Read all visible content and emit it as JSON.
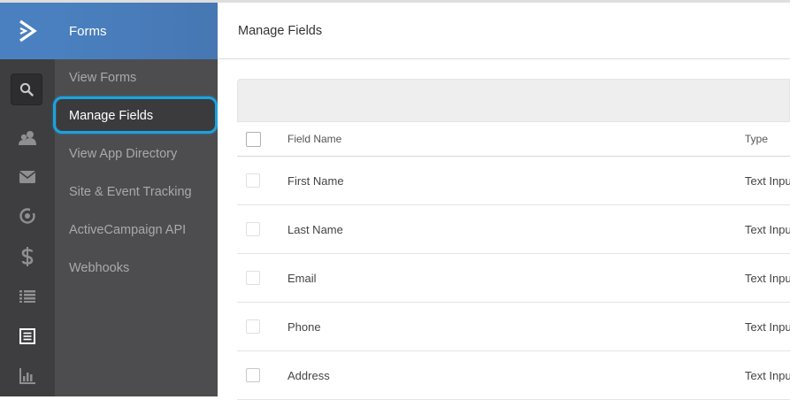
{
  "app": {
    "section_title": "Forms"
  },
  "rail": {
    "icons": [
      "search-icon",
      "contacts-icon",
      "mail-icon",
      "automation-icon",
      "dollar-icon",
      "list-icon",
      "forms-icon",
      "reports-icon"
    ]
  },
  "subnav": {
    "items": [
      {
        "label": "View Forms"
      },
      {
        "label": "Manage Fields"
      },
      {
        "label": "View App Directory"
      },
      {
        "label": "Site & Event Tracking"
      },
      {
        "label": "ActiveCampaign API"
      },
      {
        "label": "Webhooks"
      }
    ],
    "active": "Manage Fields"
  },
  "main": {
    "title": "Manage Fields",
    "table": {
      "columns": [
        "Field Name",
        "Type"
      ],
      "rows": [
        {
          "name": "First Name",
          "type": "Text Input"
        },
        {
          "name": "Last Name",
          "type": "Text Input"
        },
        {
          "name": "Email",
          "type": "Text Input"
        },
        {
          "name": "Phone",
          "type": "Text Input"
        },
        {
          "name": "Address",
          "type": "Text Input"
        }
      ]
    }
  },
  "colors": {
    "accent": "#4a80c0",
    "highlight": "#1ba3e0",
    "rail": "#3e3e40",
    "subnav": "#4d4d4f"
  }
}
